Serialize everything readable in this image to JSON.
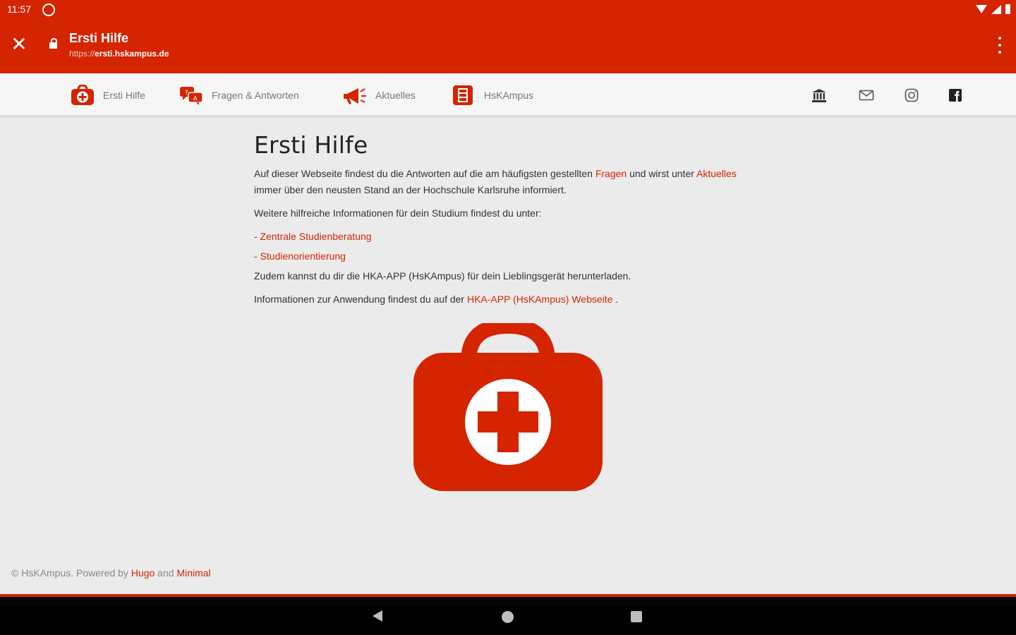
{
  "status_bar": {
    "time": "11:57"
  },
  "browser": {
    "title": "Ersti Hilfe",
    "url_protocol": "https://",
    "url_host": "ersti.hskampus.de"
  },
  "nav": {
    "items": [
      {
        "label": "Ersti Hilfe",
        "icon": "first-aid-kit-icon"
      },
      {
        "label": "Fragen & Antworten",
        "icon": "qa-bubbles-icon"
      },
      {
        "label": "Aktuelles",
        "icon": "megaphone-icon"
      },
      {
        "label": "HsKAmpus",
        "icon": "hskampus-app-icon"
      }
    ],
    "social": [
      "university-icon",
      "mail-icon",
      "instagram-icon",
      "facebook-icon"
    ]
  },
  "content": {
    "heading": "Ersti Hilfe",
    "intro_1": "Auf dieser Webseite findest du die Antworten auf die am häufigsten gestellten ",
    "intro_link_1": "Fragen",
    "intro_2": " und wirst unter ",
    "intro_link_2": "Aktuelles",
    "intro_3": " immer über den neusten Stand an der Hochschule Karlsruhe informiert.",
    "further_info": "Weitere hilfreiche Informationen für dein Studium findest du unter:",
    "link_studienberatung": "- Zentrale Studienberatung",
    "link_studienorientierung": "- Studienorientierung",
    "download_text": "Zudem kannst du dir die HKA-APP (HsKAmpus) für dein Lieblingsgerät herunterladen.",
    "app_info_1": "Informationen zur Anwendung findest du auf der ",
    "app_info_link": "HKA-APP (HsKAmpus) Webseite",
    "app_info_2": " ."
  },
  "footer": {
    "prefix": "© HsKAmpus. Powered by ",
    "hugo": "Hugo",
    "and": " and ",
    "minimal": "Minimal"
  },
  "colors": {
    "brand": "#d42400",
    "background": "#ebebeb"
  }
}
